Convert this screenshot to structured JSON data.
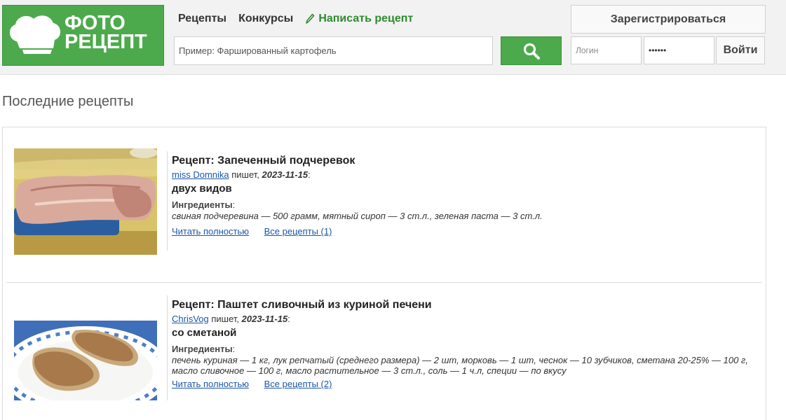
{
  "logo": {
    "line1": "ФОТО",
    "line2": "РЕЦЕПТ"
  },
  "nav": {
    "recipes": "Рецепты",
    "contests": "Конкурсы",
    "write": "Написать рецепт"
  },
  "search": {
    "placeholder": "Пример: Фаршированный картофель"
  },
  "auth": {
    "register": "Зарегистрироваться",
    "login_placeholder": "Логин",
    "password_value": "••••••",
    "login_button": "Войти"
  },
  "section_title": "Последние рецепты",
  "recipes": [
    {
      "title": "Рецепт: Запеченный подчеревок",
      "author": "miss Domnika",
      "writes": " пишет, ",
      "date": "2023-11-15",
      "date_suffix": ":",
      "subtitle": "двух видов",
      "ingredients_label": "Ингредиенты",
      "ingredients": "свиная подчеревина — 500 грамм, мятный сироп — 3 ст.л., зеленая паста — 3 ст.л.",
      "read_more": "Читать полностью",
      "all_recipes": "Все рецепты (1)"
    },
    {
      "title": "Рецепт: Паштет сливочный из куриной печени",
      "author": "ChrisVog",
      "writes": " пишет, ",
      "date": "2023-11-15",
      "date_suffix": ":",
      "subtitle": "со сметаной",
      "ingredients_label": "Ингредиенты",
      "ingredients": "печень куриная — 1 кг, лук репчатый (среднего размера) — 2 шт, морковь — 1 шт, чеснок — 10 зубчиков, сметана 20-25% — 100 г, масло сливочное — 100 г, масло растительное — 3 ст.л., соль — 1 ч.л, специи — по вкусу",
      "read_more": "Читать полностью",
      "all_recipes": "Все рецепты (2)"
    }
  ],
  "colors": {
    "brand_green": "#4caa4c",
    "link_blue": "#1a57a6",
    "header_bg": "#f2f2f2"
  },
  "icons": {
    "logo": "chef-hat-icon",
    "write": "pencil-icon",
    "search": "magnifier-icon"
  }
}
